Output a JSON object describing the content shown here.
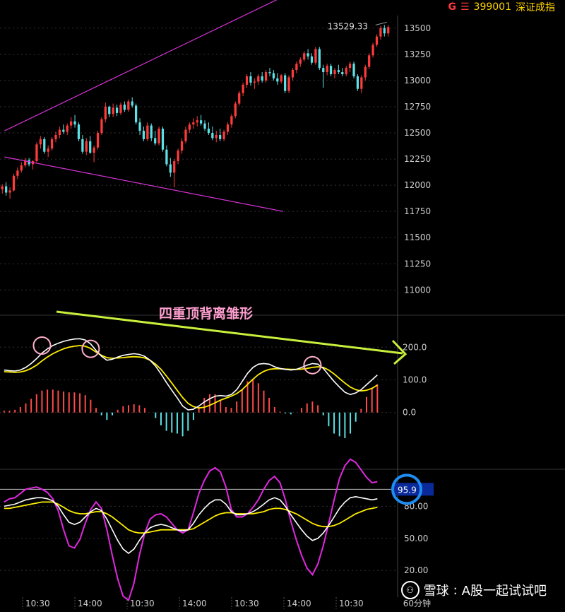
{
  "header": {
    "g_label": "G",
    "menu_glyph": "☰",
    "code": "399001",
    "name": "深证成指"
  },
  "annotation": "四重顶背离雏形",
  "timeframe": "60分钟",
  "watermark": {
    "brand": "雪球",
    "user": "A股一起试试吧"
  },
  "chart_data": [
    {
      "type": "candlestick",
      "panel": "price",
      "last_price_label": "13529.33",
      "y_ticks": [
        13500,
        13250,
        13000,
        12750,
        12500,
        12250,
        12000,
        11750,
        11500,
        11250,
        11000
      ],
      "ylim": [
        10800,
        13620
      ],
      "candles": [
        [
          11960,
          12010,
          11920,
          11990
        ],
        [
          11990,
          12030,
          11900,
          11930
        ],
        [
          11930,
          11980,
          11870,
          11950
        ],
        [
          11950,
          12110,
          11940,
          12090
        ],
        [
          12090,
          12170,
          12060,
          12140
        ],
        [
          12140,
          12220,
          12120,
          12190
        ],
        [
          12190,
          12260,
          12170,
          12240
        ],
        [
          12240,
          12260,
          12180,
          12200
        ],
        [
          12200,
          12240,
          12150,
          12230
        ],
        [
          12230,
          12410,
          12220,
          12390
        ],
        [
          12390,
          12470,
          12350,
          12440
        ],
        [
          12440,
          12460,
          12300,
          12320
        ],
        [
          12320,
          12380,
          12270,
          12350
        ],
        [
          12350,
          12460,
          12330,
          12440
        ],
        [
          12440,
          12510,
          12410,
          12480
        ],
        [
          12480,
          12560,
          12450,
          12530
        ],
        [
          12530,
          12580,
          12490,
          12510
        ],
        [
          12510,
          12590,
          12480,
          12570
        ],
        [
          12570,
          12650,
          12540,
          12610
        ],
        [
          12610,
          12670,
          12550,
          12580
        ],
        [
          12580,
          12600,
          12420,
          12440
        ],
        [
          12440,
          12480,
          12300,
          12320
        ],
        [
          12320,
          12450,
          12290,
          12420
        ],
        [
          12420,
          12470,
          12300,
          12310
        ],
        [
          12310,
          12380,
          12220,
          12360
        ],
        [
          12360,
          12520,
          12340,
          12500
        ],
        [
          12500,
          12650,
          12480,
          12630
        ],
        [
          12630,
          12790,
          12600,
          12750
        ],
        [
          12750,
          12760,
          12650,
          12680
        ],
        [
          12680,
          12780,
          12650,
          12740
        ],
        [
          12740,
          12770,
          12660,
          12690
        ],
        [
          12690,
          12790,
          12670,
          12770
        ],
        [
          12770,
          12800,
          12700,
          12720
        ],
        [
          12720,
          12820,
          12700,
          12800
        ],
        [
          12800,
          12840,
          12740,
          12760
        ],
        [
          12760,
          12780,
          12580,
          12600
        ],
        [
          12600,
          12640,
          12480,
          12520
        ],
        [
          12520,
          12560,
          12420,
          12440
        ],
        [
          12440,
          12600,
          12420,
          12570
        ],
        [
          12570,
          12590,
          12420,
          12450
        ],
        [
          12450,
          12520,
          12380,
          12400
        ],
        [
          12400,
          12560,
          12380,
          12540
        ],
        [
          12540,
          12560,
          12320,
          12340
        ],
        [
          12340,
          12380,
          12180,
          12200
        ],
        [
          12200,
          12260,
          12080,
          12120
        ],
        [
          12120,
          12250,
          11980,
          12230
        ],
        [
          12230,
          12350,
          12200,
          12330
        ],
        [
          12330,
          12450,
          12300,
          12420
        ],
        [
          12420,
          12560,
          12400,
          12530
        ],
        [
          12530,
          12600,
          12500,
          12580
        ],
        [
          12580,
          12640,
          12540,
          12600
        ],
        [
          12600,
          12660,
          12560,
          12620
        ],
        [
          12620,
          12670,
          12570,
          12590
        ],
        [
          12590,
          12620,
          12520,
          12540
        ],
        [
          12540,
          12600,
          12480,
          12500
        ],
        [
          12500,
          12560,
          12430,
          12450
        ],
        [
          12450,
          12520,
          12410,
          12480
        ],
        [
          12480,
          12540,
          12420,
          12440
        ],
        [
          12440,
          12530,
          12420,
          12510
        ],
        [
          12510,
          12600,
          12480,
          12580
        ],
        [
          12580,
          12680,
          12550,
          12660
        ],
        [
          12660,
          12800,
          12640,
          12780
        ],
        [
          12780,
          12900,
          12760,
          12880
        ],
        [
          12880,
          12980,
          12850,
          12960
        ],
        [
          12960,
          13060,
          12930,
          13040
        ],
        [
          13040,
          13080,
          12950,
          12980
        ],
        [
          12980,
          13020,
          12920,
          12990
        ],
        [
          12990,
          13060,
          12960,
          13040
        ],
        [
          13040,
          13080,
          12980,
          13000
        ],
        [
          13000,
          13100,
          12980,
          13080
        ],
        [
          13080,
          13120,
          13040,
          13070
        ],
        [
          13070,
          13100,
          13000,
          13020
        ],
        [
          13020,
          13070,
          12960,
          12990
        ],
        [
          12990,
          13060,
          12970,
          13050
        ],
        [
          13050,
          13070,
          12880,
          12900
        ],
        [
          12900,
          13050,
          12880,
          13030
        ],
        [
          13030,
          13120,
          13000,
          13100
        ],
        [
          13100,
          13180,
          13070,
          13160
        ],
        [
          13160,
          13220,
          13130,
          13200
        ],
        [
          13200,
          13280,
          13180,
          13260
        ],
        [
          13260,
          13300,
          13200,
          13230
        ],
        [
          13230,
          13260,
          13150,
          13170
        ],
        [
          13170,
          13320,
          13150,
          13300
        ],
        [
          13300,
          13320,
          13100,
          13120
        ],
        [
          13120,
          13150,
          12930,
          13080
        ],
        [
          13080,
          13160,
          13050,
          13140
        ],
        [
          13140,
          13160,
          13040,
          13060
        ],
        [
          13060,
          13120,
          13020,
          13100
        ],
        [
          13100,
          13150,
          13060,
          13080
        ],
        [
          13080,
          13120,
          13040,
          13060
        ],
        [
          13060,
          13140,
          13040,
          13120
        ],
        [
          13120,
          13180,
          13080,
          13160
        ],
        [
          13160,
          13180,
          13020,
          13040
        ],
        [
          13040,
          13060,
          12900,
          12920
        ],
        [
          12920,
          13050,
          12880,
          13030
        ],
        [
          13030,
          13150,
          13000,
          13130
        ],
        [
          13130,
          13260,
          13110,
          13240
        ],
        [
          13240,
          13360,
          13220,
          13340
        ],
        [
          13340,
          13440,
          13320,
          13420
        ],
        [
          13420,
          13520,
          13390,
          13500
        ],
        [
          13500,
          13530,
          13420,
          13450
        ],
        [
          13450,
          13530,
          13420,
          13510
        ]
      ],
      "trendlines": [
        {
          "from": [
            0.6,
            12520
          ],
          "to": [
            73.5,
            13800
          ]
        },
        {
          "from": [
            0.6,
            12270
          ],
          "to": [
            73.5,
            11750
          ]
        }
      ]
    },
    {
      "type": "macd",
      "panel": "macd",
      "y_ticks": [
        200.0,
        100.0,
        0.0
      ],
      "ylim": [
        -165,
        285
      ],
      "line_white": [
        130,
        128,
        127,
        130,
        138,
        150,
        165,
        182,
        195,
        205,
        212,
        218,
        222,
        225,
        226,
        222,
        210,
        190,
        172,
        160,
        163,
        170,
        175,
        178,
        180,
        178,
        172,
        160,
        142,
        118,
        92,
        68,
        45,
        20,
        8,
        10,
        20,
        32,
        42,
        50,
        52,
        50,
        55,
        70,
        95,
        120,
        138,
        148,
        150,
        148,
        140,
        135,
        132,
        130,
        132,
        138,
        145,
        150,
        148,
        135,
        115,
        95,
        78,
        62,
        55,
        60,
        70,
        85,
        100,
        115
      ],
      "line_yellow": [
        125,
        124,
        123,
        124,
        128,
        135,
        145,
        158,
        170,
        180,
        188,
        195,
        200,
        203,
        205,
        203,
        196,
        185,
        175,
        168,
        166,
        167,
        168,
        170,
        171,
        170,
        167,
        160,
        148,
        132,
        112,
        90,
        68,
        46,
        28,
        18,
        14,
        16,
        22,
        30,
        38,
        44,
        50,
        58,
        70,
        86,
        102,
        116,
        126,
        132,
        134,
        134,
        133,
        132,
        132,
        133,
        135,
        138,
        140,
        138,
        130,
        118,
        104,
        90,
        78,
        70,
        66,
        68,
        74,
        84
      ],
      "histogram": [
        2,
        2,
        3,
        6,
        10,
        15,
        20,
        24,
        25,
        25,
        24,
        23,
        22,
        22,
        21,
        19,
        14,
        5,
        -3,
        -8,
        -3,
        3,
        7,
        8,
        9,
        8,
        5,
        0,
        -6,
        -14,
        -20,
        -22,
        -23,
        -26,
        -20,
        -8,
        6,
        16,
        20,
        20,
        14,
        6,
        5,
        12,
        25,
        34,
        36,
        32,
        24,
        16,
        6,
        1,
        -1,
        -2,
        0,
        5,
        10,
        12,
        8,
        -3,
        -15,
        -23,
        -26,
        -28,
        -23,
        -10,
        4,
        17,
        26,
        31
      ],
      "markers": [
        {
          "index": 7,
          "value": 205
        },
        {
          "index": 16,
          "value": 195
        },
        {
          "index": 57,
          "value": 145
        }
      ],
      "trend_arrow": {
        "from": [
          0.5,
          285
        ],
        "to": [
          74.5,
          225
        ]
      }
    },
    {
      "type": "kdj",
      "panel": "kdj",
      "y_ticks": [
        80.0,
        50.0,
        20.0
      ],
      "ylim": [
        -5,
        112
      ],
      "current_label": "95.9",
      "ref_line": 95.9,
      "k": [
        80,
        81,
        82,
        84,
        86,
        87,
        88,
        88,
        87,
        85,
        80,
        72,
        65,
        63,
        65,
        70,
        75,
        78,
        76,
        68,
        58,
        48,
        40,
        36,
        40,
        48,
        55,
        60,
        62,
        63,
        62,
        60,
        58,
        57,
        58,
        64,
        72,
        78,
        83,
        86,
        86,
        82,
        75,
        72,
        72,
        73,
        75,
        78,
        82,
        86,
        88,
        86,
        80,
        72,
        65,
        58,
        52,
        48,
        50,
        55,
        62,
        70,
        78,
        84,
        88,
        89,
        88,
        87,
        86,
        87
      ],
      "d": [
        78,
        78,
        79,
        80,
        81,
        82,
        83,
        84,
        84,
        84,
        82,
        79,
        76,
        74,
        73,
        73,
        74,
        75,
        75,
        73,
        70,
        66,
        62,
        58,
        56,
        55,
        55,
        56,
        57,
        58,
        58,
        58,
        58,
        58,
        58,
        59,
        62,
        65,
        68,
        71,
        73,
        74,
        74,
        73,
        73,
        73,
        73,
        74,
        75,
        77,
        78,
        78,
        77,
        75,
        73,
        70,
        67,
        64,
        62,
        61,
        61,
        62,
        64,
        67,
        70,
        73,
        75,
        77,
        78,
        79
      ],
      "j": [
        84,
        87,
        88,
        92,
        96,
        97,
        98,
        96,
        93,
        87,
        76,
        58,
        43,
        41,
        49,
        64,
        77,
        84,
        78,
        58,
        34,
        12,
        -4,
        -8,
        8,
        34,
        55,
        68,
        72,
        73,
        70,
        64,
        58,
        55,
        58,
        74,
        92,
        104,
        113,
        116,
        112,
        98,
        77,
        70,
        70,
        73,
        79,
        86,
        96,
        104,
        108,
        102,
        86,
        66,
        49,
        34,
        22,
        16,
        26,
        43,
        64,
        86,
        106,
        118,
        124,
        121,
        114,
        107,
        102,
        103
      ],
      "magenta_curve_note": "J line shown with emphasis"
    }
  ],
  "time_labels": [
    "10:30",
    "14:00",
    "10:30",
    "14:00",
    "10:30",
    "14:00",
    "10:30"
  ]
}
